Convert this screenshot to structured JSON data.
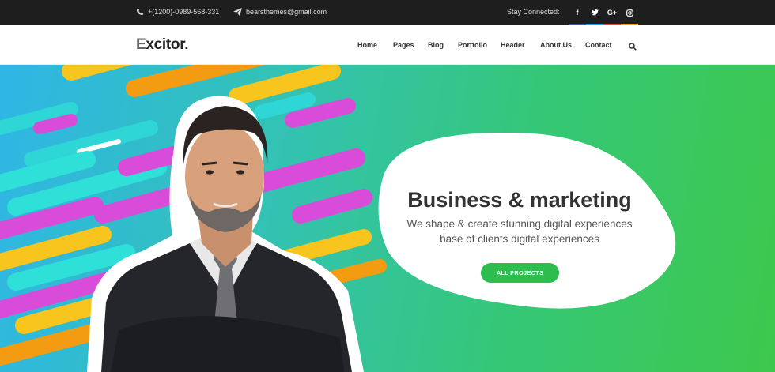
{
  "topbar": {
    "phone": "+(1200)-0989-568-331",
    "email": "bearsthemes@gmail.com",
    "stay_connected": "Stay Connected:",
    "socials": [
      {
        "icon": "facebook-icon",
        "glyph": "f",
        "accent": "#3b5998"
      },
      {
        "icon": "twitter-icon",
        "glyph": "t",
        "accent": "#1da1f2"
      },
      {
        "icon": "google-plus-icon",
        "glyph": "G+",
        "accent": "#dd4b39"
      },
      {
        "icon": "instagram-icon",
        "glyph": "ig",
        "accent": "#f39c12"
      }
    ]
  },
  "header": {
    "logo": "Excitor.",
    "nav": [
      "Home",
      "Pages",
      "Blog",
      "Portfolio",
      "Header",
      "About Us",
      "Contact"
    ],
    "search_icon": "search-icon"
  },
  "hero": {
    "title": "Business & marketing",
    "subtitle_line1": "We shape & create stunning digital experiences",
    "subtitle_line2": "base of clients digital experiences",
    "cta": "ALL PROJECTS"
  },
  "colors": {
    "topbar_bg": "#1e1e1e",
    "accent_green": "#2dbd4e"
  }
}
